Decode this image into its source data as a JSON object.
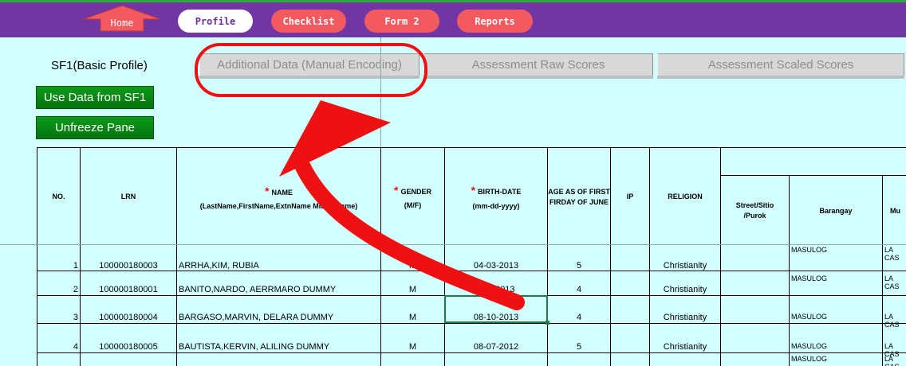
{
  "nav": {
    "home": "Home",
    "profile": "Profile",
    "checklist": "Checklist",
    "form2": "Form 2",
    "reports": "Reports"
  },
  "tabs": {
    "sf1": "SF1(Basic Profile)",
    "additional": "Additional Data  (Manual Encoding)",
    "raw": "Assessment Raw Scores",
    "scaled": "Assessment Scaled Scores"
  },
  "buttons": {
    "use_data": "Use Data from SF1",
    "unfreeze": "Unfreeze Pane"
  },
  "headers": {
    "no": "NO.",
    "lrn": "LRN",
    "name": "NAME",
    "name_sub": "(LastName,FirstName,ExtnName MiddleName)",
    "gender": "GENDER",
    "gender_sub": "(M/F)",
    "birth": "BIRTH-DATE",
    "birth_sub": "(mm-dd-yyyy)",
    "age1": "AGE AS OF FIRST",
    "age2": "FIRDAY OF JUNE",
    "ip": "IP",
    "religion": "RELIGION",
    "street1": "Street/Sitio",
    "street2": "/Purok",
    "barangay": "Barangay",
    "municipality": "Mu"
  },
  "rows": [
    {
      "no": "1",
      "lrn": "100000180003",
      "name": "ARRHA,KIM, RUBIA",
      "gender": "M",
      "birth": "04-03-2013",
      "age": "5",
      "religion": "Christianity",
      "barangay": "MASULOG",
      "municipality": "LA CAS"
    },
    {
      "no": "2",
      "lrn": "100000180001",
      "name": "BANITO,NARDO, AERRMARO  DUMMY",
      "gender": "M",
      "birth": "09-  -2013",
      "age": "4",
      "religion": "Christianity",
      "barangay": "MASULOG",
      "municipality": "LA CAS"
    },
    {
      "no": "3",
      "lrn": "100000180004",
      "name": "BARGASO,MARVIN, DELARA  DUMMY",
      "gender": "M",
      "birth": "08-10-2013",
      "age": "4",
      "religion": "Christianity",
      "barangay": "MASULOG",
      "municipality": "LA CAS"
    },
    {
      "no": "4",
      "lrn": "100000180005",
      "name": "BAUTISTA,KERVIN, ALILING  DUMMY",
      "gender": "M",
      "birth": "08-07-2012",
      "age": "5",
      "religion": "Christianity",
      "barangay": "MASULOG",
      "municipality": "LA CAS"
    },
    {
      "no": "",
      "lrn": "",
      "name": "",
      "gender": "",
      "birth": "",
      "age": "",
      "religion": "",
      "barangay": "MASULOG",
      "municipality": "LA CAS"
    }
  ],
  "colors": {
    "topbar": "#7236a4",
    "pill": "#f25a5f",
    "sheet": "#d2ffff",
    "annotation": "#ee1111"
  }
}
